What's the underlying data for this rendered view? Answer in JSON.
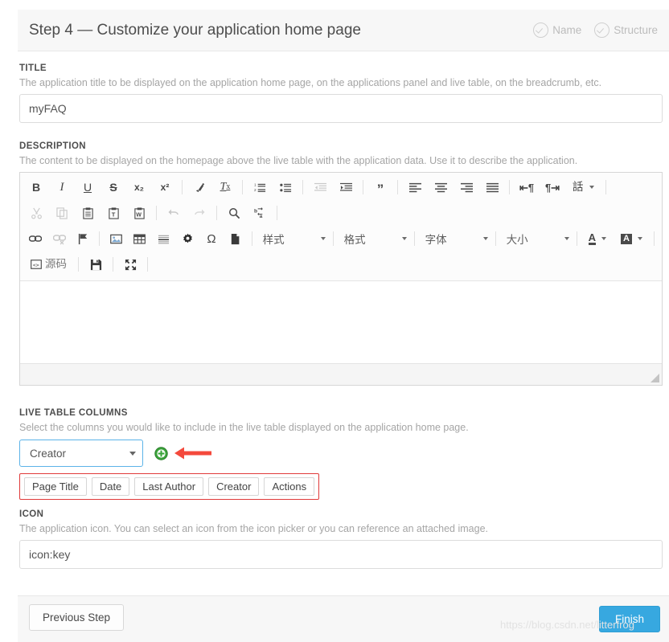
{
  "header": {
    "title": "Step 4 — Customize your application home page",
    "steps": [
      {
        "label": "Name",
        "icon": "check-circle-icon",
        "state": "completed"
      },
      {
        "label": "Structure",
        "icon": "check-circle-icon",
        "state": "completed"
      }
    ]
  },
  "title_field": {
    "label": "TITLE",
    "hint": "The application title to be displayed on the application home page, on the applications panel and live table, on the breadcrumb, etc.",
    "value": "myFAQ",
    "placeholder": ""
  },
  "description_field": {
    "label": "DESCRIPTION",
    "hint": "The content to be displayed on the homepage above the live table with the application data. Use it to describe the application.",
    "value": ""
  },
  "editor": {
    "row1": [
      {
        "name": "bold-icon",
        "glyph": "B",
        "kind": "text",
        "style": "bold"
      },
      {
        "name": "italic-icon",
        "glyph": "I",
        "kind": "text",
        "style": "italic"
      },
      {
        "name": "underline-icon",
        "glyph": "U",
        "kind": "text",
        "style": "underline"
      },
      {
        "name": "strikethrough-icon",
        "glyph": "S",
        "kind": "text",
        "style": "strike"
      },
      {
        "name": "subscript-icon",
        "glyph": "x₂",
        "kind": "text"
      },
      {
        "name": "superscript-icon",
        "glyph": "x²",
        "kind": "text"
      },
      {
        "name": "separator",
        "kind": "sep"
      },
      {
        "name": "remove-format-brush-icon",
        "kind": "svg-brush"
      },
      {
        "name": "remove-format-icon",
        "glyph": "Tx",
        "kind": "text",
        "style": "italic"
      },
      {
        "name": "separator",
        "kind": "sep"
      },
      {
        "name": "numbered-list-icon",
        "kind": "svg-numlist"
      },
      {
        "name": "bulleted-list-icon",
        "kind": "svg-bullist"
      },
      {
        "name": "separator",
        "kind": "sep"
      },
      {
        "name": "decrease-indent-icon",
        "kind": "svg-outdent",
        "disabled": true
      },
      {
        "name": "increase-indent-icon",
        "kind": "svg-indent"
      },
      {
        "name": "separator",
        "kind": "sep"
      },
      {
        "name": "blockquote-icon",
        "glyph": "❞",
        "kind": "text"
      },
      {
        "name": "separator",
        "kind": "sep"
      },
      {
        "name": "align-left-icon",
        "kind": "svg-align-left"
      },
      {
        "name": "align-center-icon",
        "kind": "svg-align-center"
      },
      {
        "name": "align-right-icon",
        "kind": "svg-align-right"
      },
      {
        "name": "align-justify-icon",
        "kind": "svg-align-justify"
      },
      {
        "name": "separator",
        "kind": "sep"
      },
      {
        "name": "text-direction-ltr-icon",
        "glyph": "⁌¶",
        "kind": "text"
      },
      {
        "name": "text-direction-rtl-icon",
        "glyph": "¶⁍",
        "kind": "text"
      },
      {
        "name": "language-dropdown",
        "glyph": "話",
        "kind": "text-caret"
      }
    ],
    "row2": [
      {
        "name": "cut-icon",
        "kind": "svg-cut",
        "disabled": true
      },
      {
        "name": "copy-icon",
        "kind": "svg-copy",
        "disabled": true
      },
      {
        "name": "paste-icon",
        "kind": "svg-paste"
      },
      {
        "name": "paste-as-text-icon",
        "kind": "svg-paste-text"
      },
      {
        "name": "paste-from-word-icon",
        "kind": "svg-paste-word"
      },
      {
        "name": "separator",
        "kind": "sep"
      },
      {
        "name": "undo-icon",
        "kind": "svg-undo",
        "disabled": true
      },
      {
        "name": "redo-icon",
        "kind": "svg-redo",
        "disabled": true
      },
      {
        "name": "separator",
        "kind": "sep"
      },
      {
        "name": "find-icon",
        "kind": "svg-find"
      },
      {
        "name": "replace-icon",
        "kind": "svg-replace"
      },
      {
        "name": "separator",
        "kind": "sep"
      }
    ],
    "row3": [
      {
        "name": "link-icon",
        "kind": "svg-link"
      },
      {
        "name": "unlink-icon",
        "kind": "svg-unlink",
        "disabled": true
      },
      {
        "name": "anchor-flag-icon",
        "kind": "svg-flag"
      },
      {
        "name": "separator",
        "kind": "sep"
      },
      {
        "name": "image-icon",
        "kind": "svg-image"
      },
      {
        "name": "table-icon",
        "kind": "svg-table"
      },
      {
        "name": "horizontal-rule-icon",
        "kind": "svg-hr"
      },
      {
        "name": "settings-gear-icon",
        "kind": "svg-gear"
      },
      {
        "name": "special-character-icon",
        "glyph": "Ω",
        "kind": "text"
      },
      {
        "name": "page-break-icon",
        "kind": "svg-pagebreak"
      },
      {
        "name": "separator",
        "kind": "sep"
      }
    ],
    "dropdowns": [
      {
        "name": "styles-dropdown",
        "label": "样式"
      },
      {
        "name": "format-dropdown",
        "label": "格式"
      },
      {
        "name": "font-dropdown",
        "label": "字体"
      },
      {
        "name": "font-size-dropdown",
        "label": "大小"
      }
    ],
    "colors": [
      {
        "name": "text-color-picker",
        "glyph": "A"
      },
      {
        "name": "background-color-picker",
        "glyph": "A"
      }
    ],
    "row4": [
      {
        "name": "source-code-button",
        "label": "源码"
      },
      {
        "name": "save-icon",
        "kind": "svg-save"
      },
      {
        "name": "maximize-icon",
        "kind": "svg-maximize"
      }
    ]
  },
  "live_table": {
    "label": "LIVE TABLE COLUMNS",
    "hint": "Select the columns you would like to include in the live table displayed on the application home page.",
    "selected_column": "Creator",
    "add_button": "add-column-icon",
    "annotation_arrow": "red-arrow-annotation",
    "columns": [
      "Page Title",
      "Date",
      "Last Author",
      "Creator",
      "Actions"
    ]
  },
  "icon_field": {
    "label": "ICON",
    "hint": "The application icon. You can select an icon from the icon picker or you can reference an attached image.",
    "value": "icon:key",
    "placeholder": ""
  },
  "footer": {
    "previous_label": "Previous Step",
    "finish_label": "Finish"
  },
  "watermark": "https://blog.csdn.net/litterfrog",
  "colors": {
    "accent": "#37a8e0",
    "annotation": "#e03a3a",
    "focus_border": "#5bb3e8",
    "add_green": "#3aa43a"
  }
}
